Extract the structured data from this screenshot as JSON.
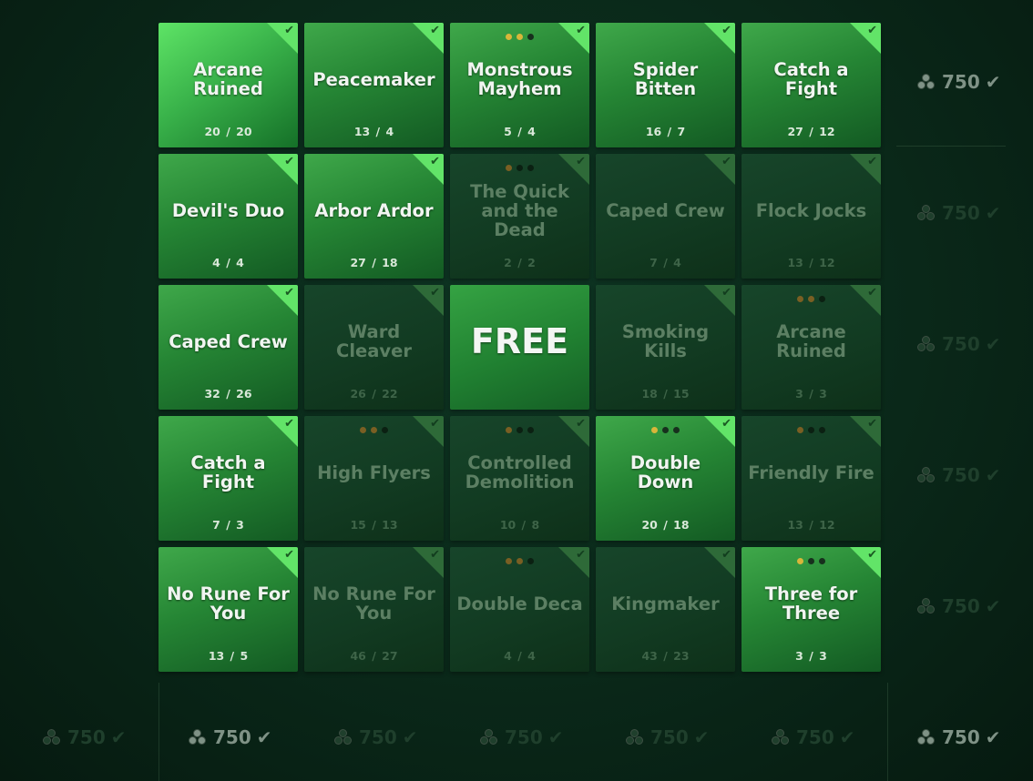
{
  "board": {
    "tiles": [
      {
        "name": "Arcane Ruined",
        "progress": "20 / 20",
        "state": "hi",
        "dots": []
      },
      {
        "name": "Peacemaker",
        "progress": "13 / 4",
        "state": "on",
        "dots": []
      },
      {
        "name": "Monstrous Mayhem",
        "progress": "5 / 4",
        "state": "on",
        "dots": [
          "g",
          "g",
          "d"
        ]
      },
      {
        "name": "Spider Bitten",
        "progress": "16 / 7",
        "state": "on",
        "dots": []
      },
      {
        "name": "Catch a Fight",
        "progress": "27 / 12",
        "state": "on",
        "dots": []
      },
      {
        "name": "Devil's Duo",
        "progress": "4 / 4",
        "state": "on",
        "dots": []
      },
      {
        "name": "Arbor Ardor",
        "progress": "27 / 18",
        "state": "on",
        "dots": []
      },
      {
        "name": "The Quick and the Dead",
        "progress": "2 / 2",
        "state": "off",
        "dots": [
          "g",
          "d",
          "d"
        ]
      },
      {
        "name": "Caped Crew",
        "progress": "7 / 4",
        "state": "off",
        "dots": []
      },
      {
        "name": "Flock Jocks",
        "progress": "13 / 12",
        "state": "off",
        "dots": []
      },
      {
        "name": "Caped Crew",
        "progress": "32 / 26",
        "state": "on",
        "dots": []
      },
      {
        "name": "Ward Cleaver",
        "progress": "26 / 22",
        "state": "off",
        "dots": []
      },
      {
        "name": "FREE",
        "progress": "",
        "state": "free",
        "dots": []
      },
      {
        "name": "Smoking Kills",
        "progress": "18 / 15",
        "state": "off",
        "dots": []
      },
      {
        "name": "Arcane Ruined",
        "progress": "3 / 3",
        "state": "off",
        "dots": [
          "g",
          "g",
          "d"
        ]
      },
      {
        "name": "Catch a Fight",
        "progress": "7 / 3",
        "state": "on",
        "dots": []
      },
      {
        "name": "High Flyers",
        "progress": "15 / 13",
        "state": "off",
        "dots": [
          "g",
          "g",
          "d"
        ]
      },
      {
        "name": "Controlled Demolition",
        "progress": "10 / 8",
        "state": "off",
        "dots": [
          "g",
          "d",
          "d"
        ]
      },
      {
        "name": "Double Down",
        "progress": "20 / 18",
        "state": "on",
        "dots": [
          "g",
          "d",
          "d"
        ]
      },
      {
        "name": "Friendly Fire",
        "progress": "13 / 12",
        "state": "off",
        "dots": [
          "g",
          "d",
          "d"
        ]
      },
      {
        "name": "No Rune For You",
        "progress": "13 / 5",
        "state": "on",
        "dots": []
      },
      {
        "name": "No Rune For You",
        "progress": "46 / 27",
        "state": "off",
        "dots": []
      },
      {
        "name": "Double Deca",
        "progress": "4 / 4",
        "state": "off",
        "dots": [
          "g",
          "g",
          "d"
        ]
      },
      {
        "name": "Kingmaker",
        "progress": "43 / 23",
        "state": "off",
        "dots": []
      },
      {
        "name": "Three for Three",
        "progress": "3 / 3",
        "state": "on",
        "dots": [
          "g",
          "d",
          "d"
        ]
      }
    ]
  },
  "row_rewards": [
    {
      "amount": "750",
      "state": "bright"
    },
    {
      "amount": "750",
      "state": "dim"
    },
    {
      "amount": "750",
      "state": "dim"
    },
    {
      "amount": "750",
      "state": "dim"
    },
    {
      "amount": "750",
      "state": "dim"
    }
  ],
  "column_rewards": [
    {
      "amount": "750",
      "state": "dim"
    },
    {
      "amount": "750",
      "state": "bright"
    },
    {
      "amount": "750",
      "state": "dim"
    },
    {
      "amount": "750",
      "state": "dim"
    },
    {
      "amount": "750",
      "state": "dim"
    },
    {
      "amount": "750",
      "state": "dim"
    },
    {
      "amount": "750",
      "state": "bright"
    }
  ],
  "icons": {
    "reward": "shard-cluster-icon",
    "completed": "checkmark-icon"
  },
  "colors": {
    "tile_complete": "#39b24a",
    "tile_incomplete": "#17452a",
    "corner_complete": "#62e468",
    "dot_gold": "#d8b63a"
  }
}
